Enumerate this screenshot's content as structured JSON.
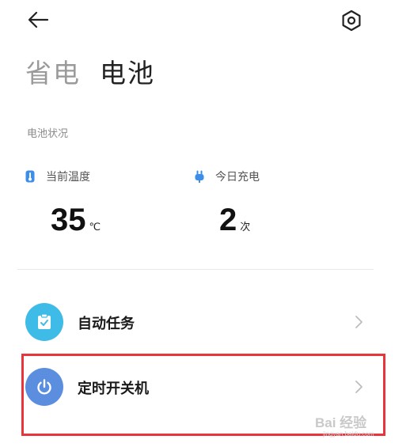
{
  "header": {
    "back_icon": "arrow-left-icon",
    "settings_icon": "settings-hex-icon"
  },
  "tabs": [
    {
      "label": "省电",
      "active": false
    },
    {
      "label": "电池",
      "active": true
    }
  ],
  "battery_status": {
    "section_title": "电池状况",
    "temperature": {
      "label": "当前温度",
      "value": "35",
      "unit": "℃",
      "icon": "thermometer-icon"
    },
    "charge_today": {
      "label": "今日充电",
      "value": "2",
      "unit": "次",
      "icon": "plug-icon"
    }
  },
  "menu": [
    {
      "label": "自动任务",
      "icon": "clipboard-check-icon",
      "color": "#3fbbe8"
    },
    {
      "label": "定时开关机",
      "icon": "power-icon",
      "color": "#5c8ee0"
    }
  ],
  "highlight_color": "#e8343b",
  "watermark": {
    "main": "Bai 经验",
    "sub": "jingyan.baidu.com"
  }
}
